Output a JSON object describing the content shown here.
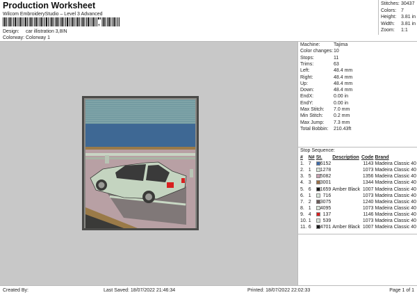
{
  "header": {
    "title": "Production Worksheet",
    "subtitle": "Wilcom EmbroideryStudio – Level 3 Advanced",
    "barcode_suffix": ",",
    "design_label": "Design:",
    "design_value": "car illistration 3,8IN",
    "colorway_label": "Colorway:",
    "colorway_value": "Colorway 1"
  },
  "stats": [
    {
      "label": "Stitches:",
      "value": "30437"
    },
    {
      "label": "Colors:",
      "value": "7"
    },
    {
      "label": "Height:",
      "value": "3.81 in"
    },
    {
      "label": "Width:",
      "value": "3.81 in"
    },
    {
      "label": "Zoom:",
      "value": "1:1"
    }
  ],
  "machine": [
    {
      "label": "Machine:",
      "value": "Tajima"
    },
    {
      "label": "Color changes:",
      "value": "10"
    },
    {
      "label": "Stops:",
      "value": "11"
    },
    {
      "label": "Trims:",
      "value": "63"
    },
    {
      "label": "Left:",
      "value": "48.4 mm"
    },
    {
      "label": "Right:",
      "value": "48.4 mm"
    },
    {
      "label": "Up:",
      "value": "48.4 mm"
    },
    {
      "label": "Down:",
      "value": "48.4 mm"
    },
    {
      "label": "EndX:",
      "value": "0.00 in"
    },
    {
      "label": "EndY:",
      "value": "0.00 in"
    },
    {
      "label": "Max Stitch:",
      "value": "7.0 mm"
    },
    {
      "label": "Min Stitch:",
      "value": "0.2 mm"
    },
    {
      "label": "Max Jump:",
      "value": "7.3 mm"
    },
    {
      "label": "Total Bobbin:",
      "value": "210.43ft"
    }
  ],
  "stop_sequence": {
    "title": "Stop Sequence:",
    "columns": [
      "#",
      "N#",
      "St.",
      "Description",
      "Code",
      "Brand"
    ],
    "rows": [
      {
        "n": "1.",
        "nn": "7",
        "color": "#3f6aa8",
        "st": "6152",
        "desc": "",
        "code": "1143",
        "brand": "Madeira Classic 40"
      },
      {
        "n": "2.",
        "nn": "1",
        "color": "#d8e4d8",
        "st": "1278",
        "desc": "",
        "code": "1073",
        "brand": "Madeira Classic 40"
      },
      {
        "n": "3.",
        "nn": "5",
        "color": "#c8a0b0",
        "st": "5082",
        "desc": "",
        "code": "1356",
        "brand": "Madeira Classic 40"
      },
      {
        "n": "4.",
        "nn": "3",
        "color": "#9a7048",
        "st": "3001",
        "desc": "",
        "code": "1344",
        "brand": "Madeira Classic 40"
      },
      {
        "n": "5.",
        "nn": "6",
        "color": "#1a1a1a",
        "st": "1659",
        "desc": "Amber Black",
        "code": "1007",
        "brand": "Madeira Classic 40"
      },
      {
        "n": "6.",
        "nn": "1",
        "color": "#d8e4d8",
        "st": "716",
        "desc": "",
        "code": "1073",
        "brand": "Madeira Classic 40"
      },
      {
        "n": "7.",
        "nn": "2",
        "color": "#6a5a58",
        "st": "3075",
        "desc": "",
        "code": "1240",
        "brand": "Madeira Classic 40"
      },
      {
        "n": "8.",
        "nn": "1",
        "color": "#d8e4d8",
        "st": "4095",
        "desc": "",
        "code": "1073",
        "brand": "Madeira Classic 40"
      },
      {
        "n": "9.",
        "nn": "4",
        "color": "#d82020",
        "st": "137",
        "desc": "",
        "code": "1146",
        "brand": "Madeira Classic 40"
      },
      {
        "n": "10.",
        "nn": "1",
        "color": "#d8e4d8",
        "st": "539",
        "desc": "",
        "code": "1073",
        "brand": "Madeira Classic 40"
      },
      {
        "n": "11.",
        "nn": "6",
        "color": "#1a1a1a",
        "st": "4701",
        "desc": "Amber Black",
        "code": "1007",
        "brand": "Madeira Classic 40"
      }
    ]
  },
  "footer": {
    "created_by": "Created By:",
    "last_saved": "Last Saved: 18/07/2022 21:46:34",
    "printed": "Printed: 18/07/2022 22:02:33",
    "page": "Page 1 of 1"
  }
}
